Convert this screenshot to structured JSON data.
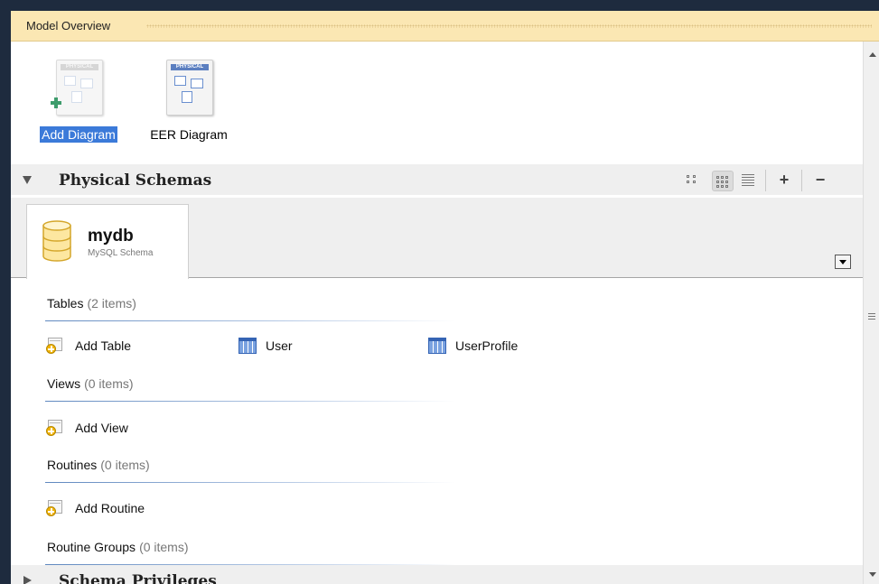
{
  "window": {
    "title": "Model Overview"
  },
  "diagrams": [
    {
      "label": "Add Diagram",
      "header": "PHYSICAL"
    },
    {
      "label": "EER Diagram",
      "header": "PHYSICAL"
    }
  ],
  "physical_schemas": {
    "title": "Physical Schemas",
    "toolbar": {
      "add_label": "+",
      "remove_label": "−"
    }
  },
  "schema": {
    "name": "mydb",
    "type": "MySQL Schema"
  },
  "groups": {
    "tables": {
      "title": "Tables",
      "count": "(2 items)",
      "add_label": "Add Table",
      "items": [
        "User",
        "UserProfile"
      ]
    },
    "views": {
      "title": "Views",
      "count": "(0 items)",
      "add_label": "Add View"
    },
    "routines": {
      "title": "Routines",
      "count": "(0 items)",
      "add_label": "Add Routine"
    },
    "routine_groups": {
      "title": "Routine Groups",
      "count": "(0 items)"
    }
  },
  "schema_privileges": {
    "title": "Schema Privileges"
  },
  "colors": {
    "title_bar": "#fbe7b3",
    "selection": "#3b7ad9",
    "table_icon": "#3564b4"
  }
}
